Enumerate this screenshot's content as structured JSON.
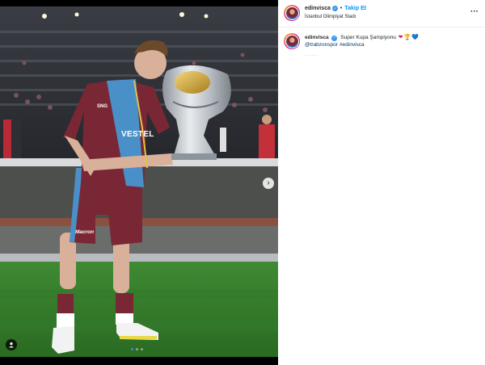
{
  "post": {
    "username": "edinvisca",
    "verified_glyph": "✓",
    "separator": "•",
    "follow_label": "Takip Et",
    "location": "İstanbul Olimpiyat Stadı",
    "more_glyph": "···",
    "caption": {
      "text": "Super Kupa Şampiyonu",
      "emojis": [
        "❤",
        "🏆",
        "💙"
      ],
      "tags": [
        "@trabzonspor",
        "#edinvisca"
      ]
    },
    "time_hint": "··· ·····"
  },
  "media": {
    "shirt_sponsor": "VESTEL",
    "shirt_brand": "SNG",
    "shorts_brand": "Macron",
    "carousel_next_glyph": "›",
    "icons": [
      "chevron-right-icon",
      "user-tag-icon"
    ],
    "pages": 3,
    "active_page": 1
  },
  "colors": {
    "claret": "#7a2735",
    "sky_blue": "#4a90c8",
    "follow_blue": "#0095f6",
    "pitch_green": "#2f7d2a"
  }
}
